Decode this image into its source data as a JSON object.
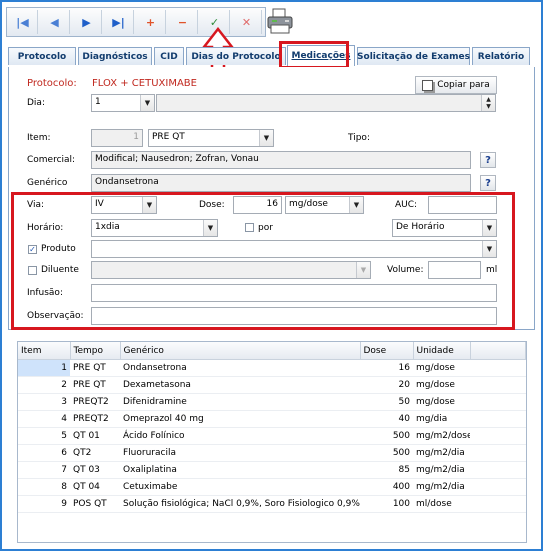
{
  "toolbar": {
    "buttons": [
      {
        "name": "first-record-icon",
        "glyph": "|◀",
        "color": "#4a7fd4"
      },
      {
        "name": "previous-record-icon",
        "glyph": "◀",
        "color": "#4a7fd4"
      },
      {
        "name": "next-record-icon",
        "glyph": "▶",
        "color": "#1f5fc9"
      },
      {
        "name": "last-record-icon",
        "glyph": "▶|",
        "color": "#1f5fc9"
      },
      {
        "name": "add-icon",
        "glyph": "+",
        "color": "#e0532a"
      },
      {
        "name": "remove-icon",
        "glyph": "−",
        "color": "#e0532a"
      },
      {
        "name": "confirm-icon",
        "glyph": "✓",
        "color": "#2e8b3a"
      },
      {
        "name": "cancel-icon",
        "glyph": "✕",
        "color": "#e06a6a"
      }
    ]
  },
  "tabs": [
    "Protocolo",
    "Diagnósticos",
    "CID",
    "Dias do Protocolo",
    "Medicações",
    "Solicitação de Exames",
    "Relatório"
  ],
  "active_tab": "Medicações",
  "form": {
    "protocol_label": "Protocolo:",
    "protocol_value": "FLOX + CETUXIMABE",
    "copy_button": "Copiar para",
    "dia_label": "Dia:",
    "dia_value": "1",
    "item_label": "Item:",
    "item_value": "1",
    "item_select": "PRE QT",
    "tipo_label": "Tipo:",
    "comercial_label": "Comercial:",
    "comercial_value": "Modifical; Nausedron; Zofran, Vonau",
    "generico_label": "Genérico",
    "generico_value": "Ondansetrona",
    "help_glyph": "?",
    "via_label": "Via:",
    "via_value": "IV",
    "dose_label": "Dose:",
    "dose_value": "16",
    "dose_unit": "mg/dose",
    "auc_label": "AUC:",
    "horario_label": "Horário:",
    "horario_value": "1xdia",
    "por_label": "por",
    "de_horario_value": "De Horário",
    "produto_label": "Produto",
    "diluente_label": "Diluente",
    "volume_label": "Volume:",
    "volume_unit": "ml",
    "infusao_label": "Infusão:",
    "observacao_label": "Observação:"
  },
  "grid": {
    "columns": [
      "Item",
      "Tempo",
      "Genérico",
      "Dose",
      "Unidade"
    ],
    "rows": [
      {
        "item": "1",
        "tempo": "PRE QT",
        "generico": "Ondansetrona",
        "dose": "16",
        "unidade": "mg/dose"
      },
      {
        "item": "2",
        "tempo": "PRE QT",
        "generico": "Dexametasona",
        "dose": "20",
        "unidade": "mg/dose"
      },
      {
        "item": "3",
        "tempo": "PREQT2",
        "generico": "Difenidramine",
        "dose": "50",
        "unidade": "mg/dose"
      },
      {
        "item": "4",
        "tempo": "PREQT2",
        "generico": "Omeprazol 40 mg",
        "dose": "40",
        "unidade": "mg/dia"
      },
      {
        "item": "5",
        "tempo": "QT 01",
        "generico": "Ácido Folínico",
        "dose": "500",
        "unidade": "mg/m2/dose"
      },
      {
        "item": "6",
        "tempo": "QT2",
        "generico": "Fluoruracila",
        "dose": "500",
        "unidade": "mg/m2/dia"
      },
      {
        "item": "7",
        "tempo": "QT 03",
        "generico": "Oxaliplatina",
        "dose": "85",
        "unidade": "mg/m2/dia"
      },
      {
        "item": "8",
        "tempo": "QT 04",
        "generico": "Cetuximabe",
        "dose": "400",
        "unidade": "mg/m2/dia"
      },
      {
        "item": "9",
        "tempo": "POS QT",
        "generico": "Solução fisiológica; NaCl 0,9%, Soro Fisiologico 0,9%",
        "dose": "100",
        "unidade": "ml/dose"
      }
    ]
  },
  "colors": {
    "accent_red": "#d7171f",
    "frame_blue": "#2d7fd3",
    "protocol_red": "#c0281f",
    "tab_text": "#123c6e"
  }
}
